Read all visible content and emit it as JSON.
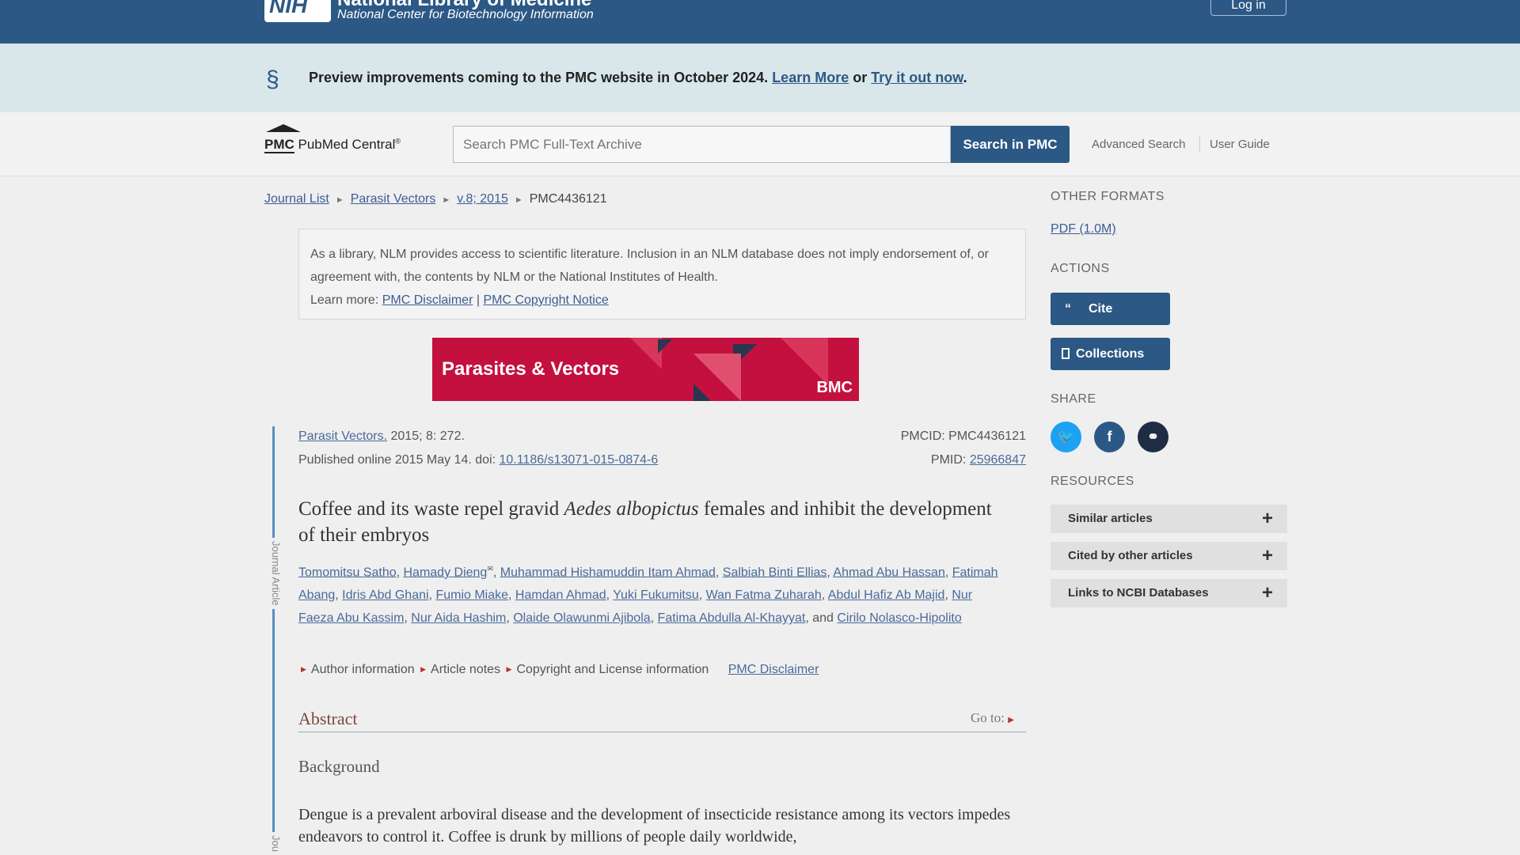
{
  "header": {
    "logo_text": "NIH",
    "org_title": "National Library of Medicine",
    "org_subtitle": "National Center for Biotechnology Information",
    "login_label": "Log in",
    "color": "#2c5885"
  },
  "banner": {
    "text": "Preview improvements coming to the PMC website in October 2024.",
    "learn_more": "Learn More",
    "or": "or",
    "try_it": "Try it out now",
    "period": "."
  },
  "search": {
    "logo_pmc": "PMC",
    "logo_name": "PubMed Central",
    "logo_reg": "®",
    "placeholder": "Search PMC Full-Text Archive",
    "button": "Search in PMC",
    "advanced": "Advanced Search",
    "user_guide": "User Guide"
  },
  "breadcrumb": {
    "items": [
      "Journal List",
      "Parasit Vectors",
      "v.8; 2015"
    ],
    "current": "PMC4436121",
    "sep": "►"
  },
  "disclaimer": {
    "text": "As a library, NLM provides access to scientific literature. Inclusion in an NLM database does not imply endorsement of, or agreement with, the contents by NLM or the National Institutes of Health.",
    "learn_more": "Learn more:",
    "link1": "PMC Disclaimer",
    "bar": "|",
    "link2": "PMC Copyright Notice"
  },
  "journal_banner": {
    "title": "Parasites & Vectors",
    "publisher": "BMC",
    "color": "#c4103f"
  },
  "article": {
    "side_label": "Journal Article",
    "side_label2": "Jou",
    "journal": "Parasit Vectors.",
    "citation": " 2015; 8: 272.",
    "published": "Published online 2015 May 14. doi: ",
    "doi": "10.1186/s13071-015-0874-6",
    "pmcid": "PMCID: PMC4436121",
    "pmid_label": "PMID: ",
    "pmid": "25966847",
    "title_pre": "Coffee and its waste repel gravid ",
    "title_italic": "Aedes albopictus",
    "title_post": " females and inhibit the development of their embryos",
    "authors": [
      "Tomomitsu Satho",
      "Hamady Dieng",
      "Muhammad Hishamuddin Itam Ahmad",
      "Salbiah Binti Ellias",
      "Ahmad Abu Hassan",
      "Fatimah Abang",
      "Idris Abd Ghani",
      "Fumio Miake",
      "Hamdan Ahmad",
      "Yuki Fukumitsu",
      "Wan Fatma Zuharah",
      "Abdul Hafiz Ab Majid",
      "Nur Faeza Abu Kassim",
      "Nur Aida Hashim",
      "Olaide Olawunmi Ajibola",
      "Fatima Abdulla Al-Khayyat",
      "Cirilo Nolasco-Hipolito"
    ],
    "and": "and",
    "info_links": [
      "Author information",
      "Article notes",
      "Copyright and License information"
    ],
    "pmc_disclaimer": "PMC Disclaimer",
    "abstract_heading": "Abstract",
    "goto": "Go to:",
    "background_heading": "Background",
    "body": "Dengue is a prevalent arboviral disease and the development of insecticide resistance among its vectors impedes endeavors to control it. Coffee is drunk by millions of people daily worldwide,"
  },
  "sidebar": {
    "other_formats": "OTHER FORMATS",
    "pdf": "PDF (1.0M)",
    "actions": "ACTIONS",
    "cite": "Cite",
    "collections": "Collections",
    "share": "SHARE",
    "share_icons": [
      "twitter-icon",
      "facebook-icon",
      "link-icon"
    ],
    "resources": "RESOURCES",
    "resource_items": [
      "Similar articles",
      "Cited by other articles",
      "Links to NCBI Databases"
    ]
  }
}
